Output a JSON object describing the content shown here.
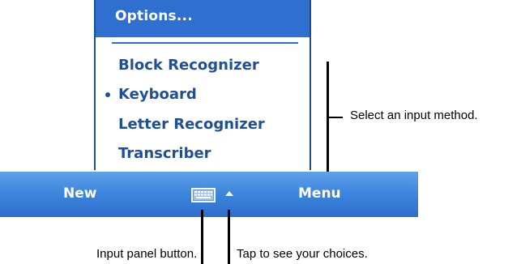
{
  "popup_menu": {
    "header_label": "Options...",
    "items": [
      {
        "label": "Block Recognizer",
        "selected": false
      },
      {
        "label": "Keyboard",
        "selected": true
      },
      {
        "label": "Letter Recognizer",
        "selected": false
      },
      {
        "label": "Transcriber",
        "selected": false
      }
    ]
  },
  "bottom_bar": {
    "left_label": "New",
    "right_label": "Menu",
    "input_panel_icon": "keyboard-icon",
    "choices_icon": "caret-up-icon"
  },
  "callouts": {
    "input_method": "Select an input method.",
    "input_panel_button": "Input panel button.",
    "see_choices": "Tap to see your choices."
  },
  "colors": {
    "menu_accent": "#2f6fcf",
    "menu_text": "#1f4f95",
    "bar_top": "#5fa2e8",
    "bar_bottom": "#2d6fcb"
  }
}
